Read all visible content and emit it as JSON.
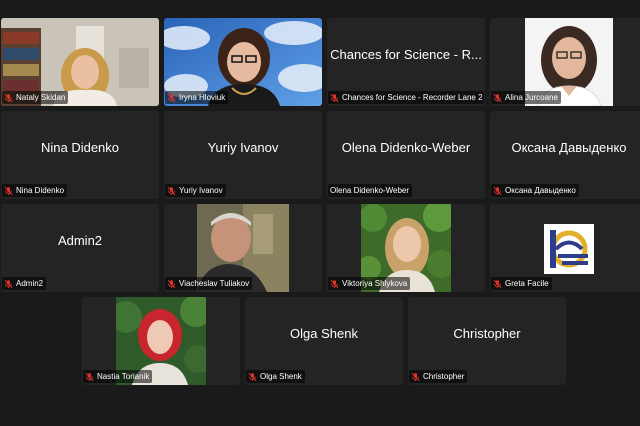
{
  "tiles": [
    {
      "name": "Nataly Skidan",
      "label": "Nataly Skidan",
      "active": true,
      "muted": true,
      "video": true,
      "avatar": "woman-bookshelf"
    },
    {
      "name": "Iryna Hloviuk",
      "label": "Iryna Hloviuk",
      "active": false,
      "muted": true,
      "video": true,
      "avatar": "woman-virtual-background"
    },
    {
      "name": "Chances for Science - R...",
      "label": "Chances for Science - Recorder Lane 2",
      "active": false,
      "muted": true,
      "video": false
    },
    {
      "name": "Alina Jurcoane",
      "label": "Alina Jurcoane",
      "active": false,
      "muted": true,
      "video": true,
      "avatar": "woman-white-background"
    },
    {
      "name": "Nina Didenko",
      "label": "Nina Didenko",
      "active": false,
      "muted": true,
      "video": false
    },
    {
      "name": "Yuriy Ivanov",
      "label": "Yuriy Ivanov",
      "active": false,
      "muted": true,
      "video": false
    },
    {
      "name": "Olena Didenko-Weber",
      "label": "Olena Didenko-Weber",
      "active": false,
      "muted": false,
      "video": false
    },
    {
      "name": "Оксана Давыденко",
      "label": "Оксана Давыденко",
      "active": false,
      "muted": true,
      "video": false
    },
    {
      "name": "Admin2",
      "label": "Admin2",
      "active": false,
      "muted": true,
      "video": false
    },
    {
      "name": "Viacheslav Tuliakov",
      "label": "Viacheslav Tuliakov",
      "active": false,
      "muted": true,
      "video": true,
      "avatar": "man-photo"
    },
    {
      "name": "Viktoriya Shlykova",
      "label": "Viktoriya Shlykova",
      "active": false,
      "muted": true,
      "video": true,
      "avatar": "woman-foliage"
    },
    {
      "name": "Greta Facile",
      "label": "Greta Facile",
      "active": false,
      "muted": true,
      "video": true,
      "avatar": "logo"
    },
    {
      "name": "Nastia Torianik",
      "label": "Nastia Torianik",
      "active": false,
      "muted": true,
      "video": true,
      "avatar": "woman-red-hair"
    },
    {
      "name": "Olga Shenk",
      "label": "Olga Shenk",
      "active": false,
      "muted": true,
      "video": false
    },
    {
      "name": "Christopher",
      "label": "Christopher",
      "active": false,
      "muted": true,
      "video": false
    }
  ],
  "colors": {
    "active_border": "#35c14e",
    "muted_icon": "#e0352b",
    "tile_bg": "#242424",
    "page_bg": "#1a1a1a"
  }
}
